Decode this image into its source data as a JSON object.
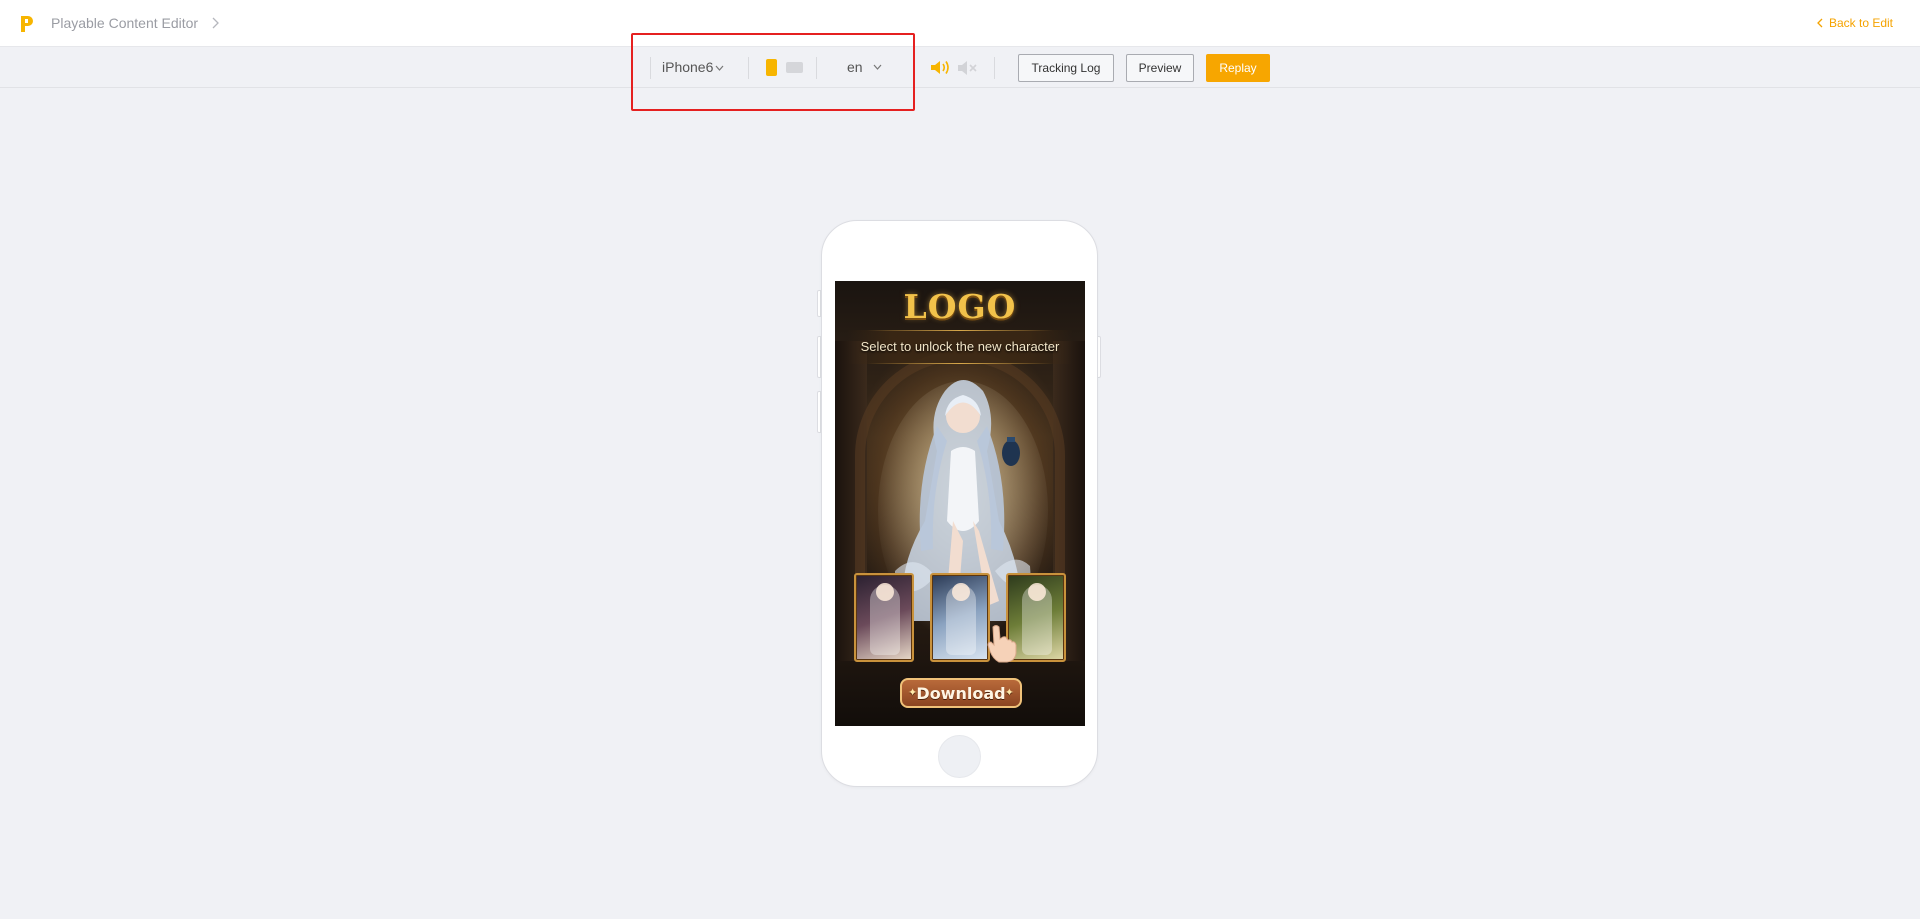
{
  "header": {
    "app_title": "Playable Content Editor",
    "back_label": "Back to Edit"
  },
  "toolbar": {
    "device": "iPhone6",
    "orientation_selected": "portrait",
    "language": "en",
    "tracking_log_label": "Tracking Log",
    "preview_label": "Preview",
    "replay_label": "Replay"
  },
  "preview": {
    "logo_text": "LOGO",
    "subtitle": "Select to unlock the new character",
    "download_label": "Download",
    "cards": [
      "character-1",
      "character-2",
      "character-3"
    ]
  },
  "colors": {
    "accent": "#f7a600",
    "highlight": "#e52020",
    "background": "#f0f1f5"
  }
}
